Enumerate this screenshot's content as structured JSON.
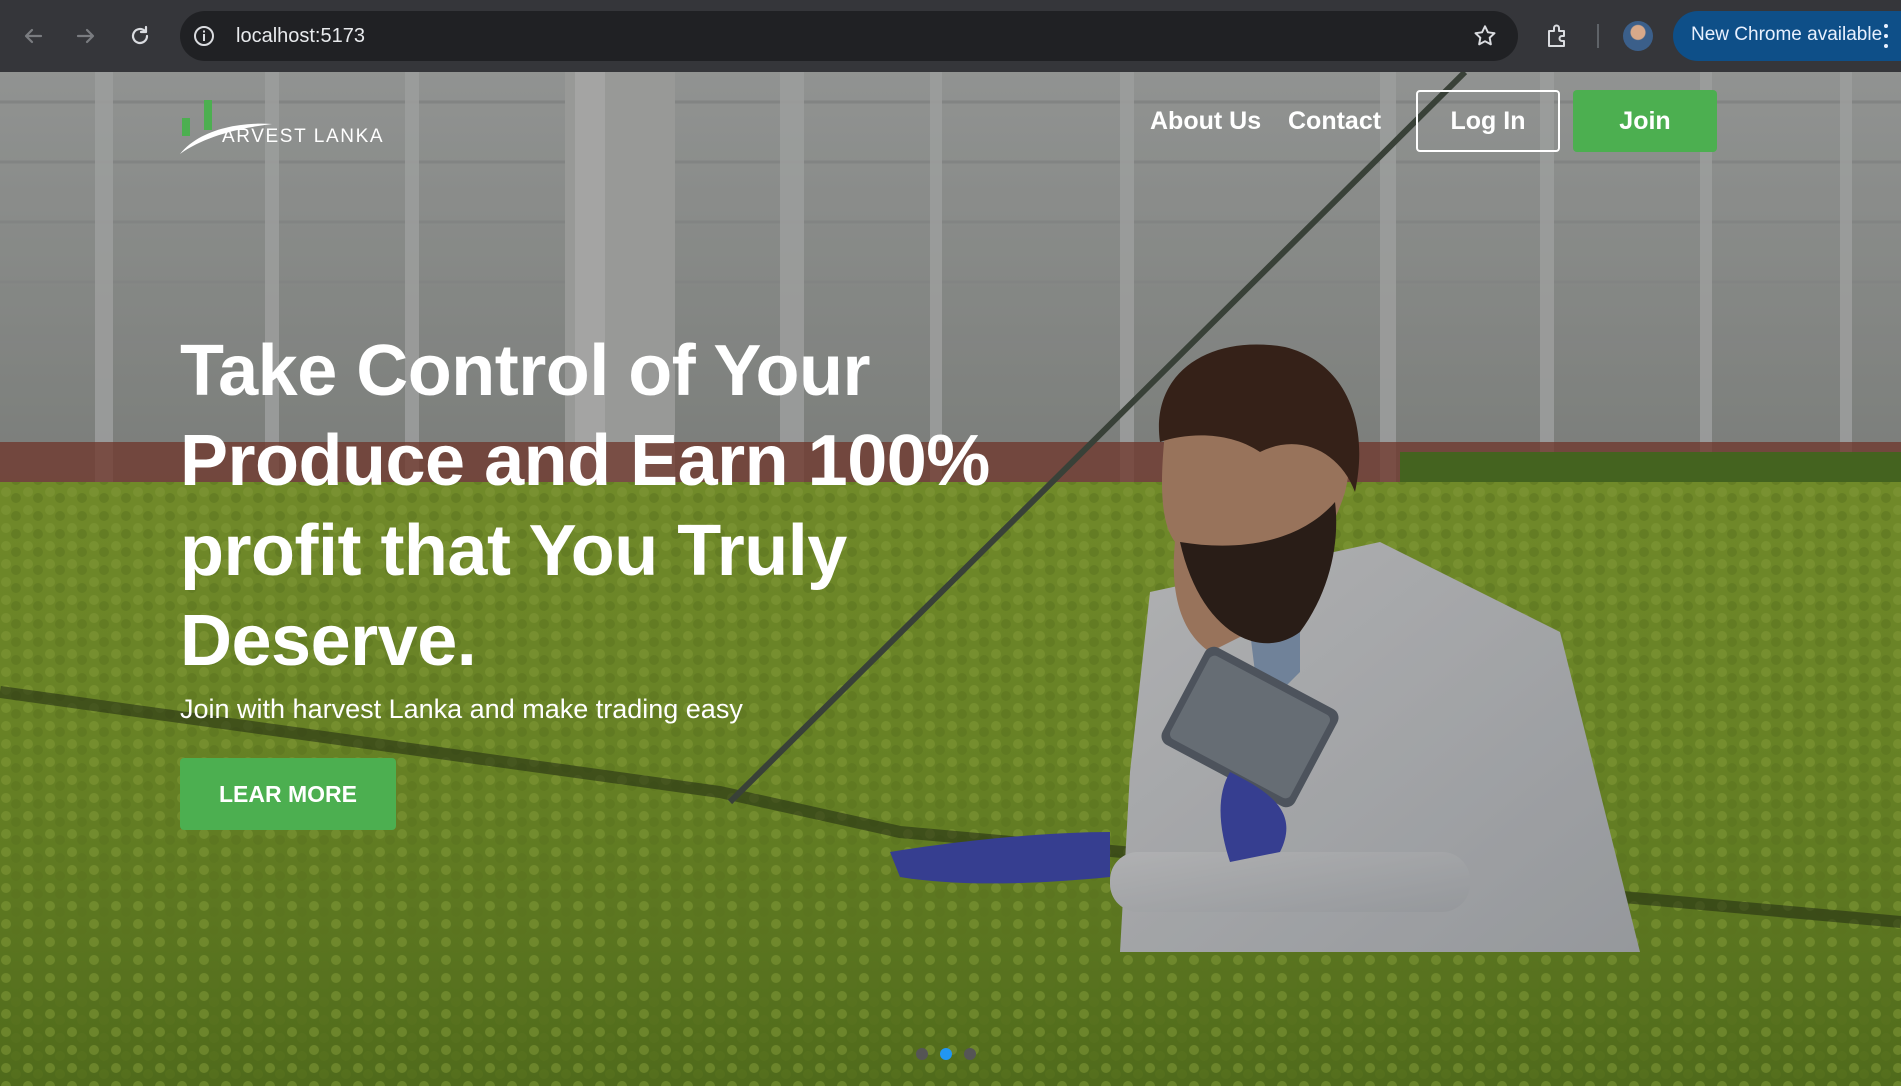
{
  "browser": {
    "url": "localhost:5173",
    "update_label": "New Chrome available",
    "icons": [
      "back-arrow-icon",
      "forward-arrow-icon",
      "reload-icon",
      "info-icon",
      "star-icon",
      "extensions-icon",
      "kebab-menu-icon"
    ]
  },
  "nav": {
    "brand": "ARVEST LANKA",
    "about": "About Us",
    "contact": "Contact",
    "login": "Log In",
    "join": "Join"
  },
  "hero": {
    "headline": "Take Control of Your Produce and Earn 100% profit that You Truly Deserve.",
    "subline": "Join with harvest Lanka and make trading easy",
    "cta": "LEAR MORE"
  },
  "carousel": {
    "slide_count": 3,
    "active_slide": 2
  },
  "colors": {
    "accent_green": "#4caf50",
    "active_dot": "#2196f3",
    "chrome_update": "#0e4f88"
  }
}
